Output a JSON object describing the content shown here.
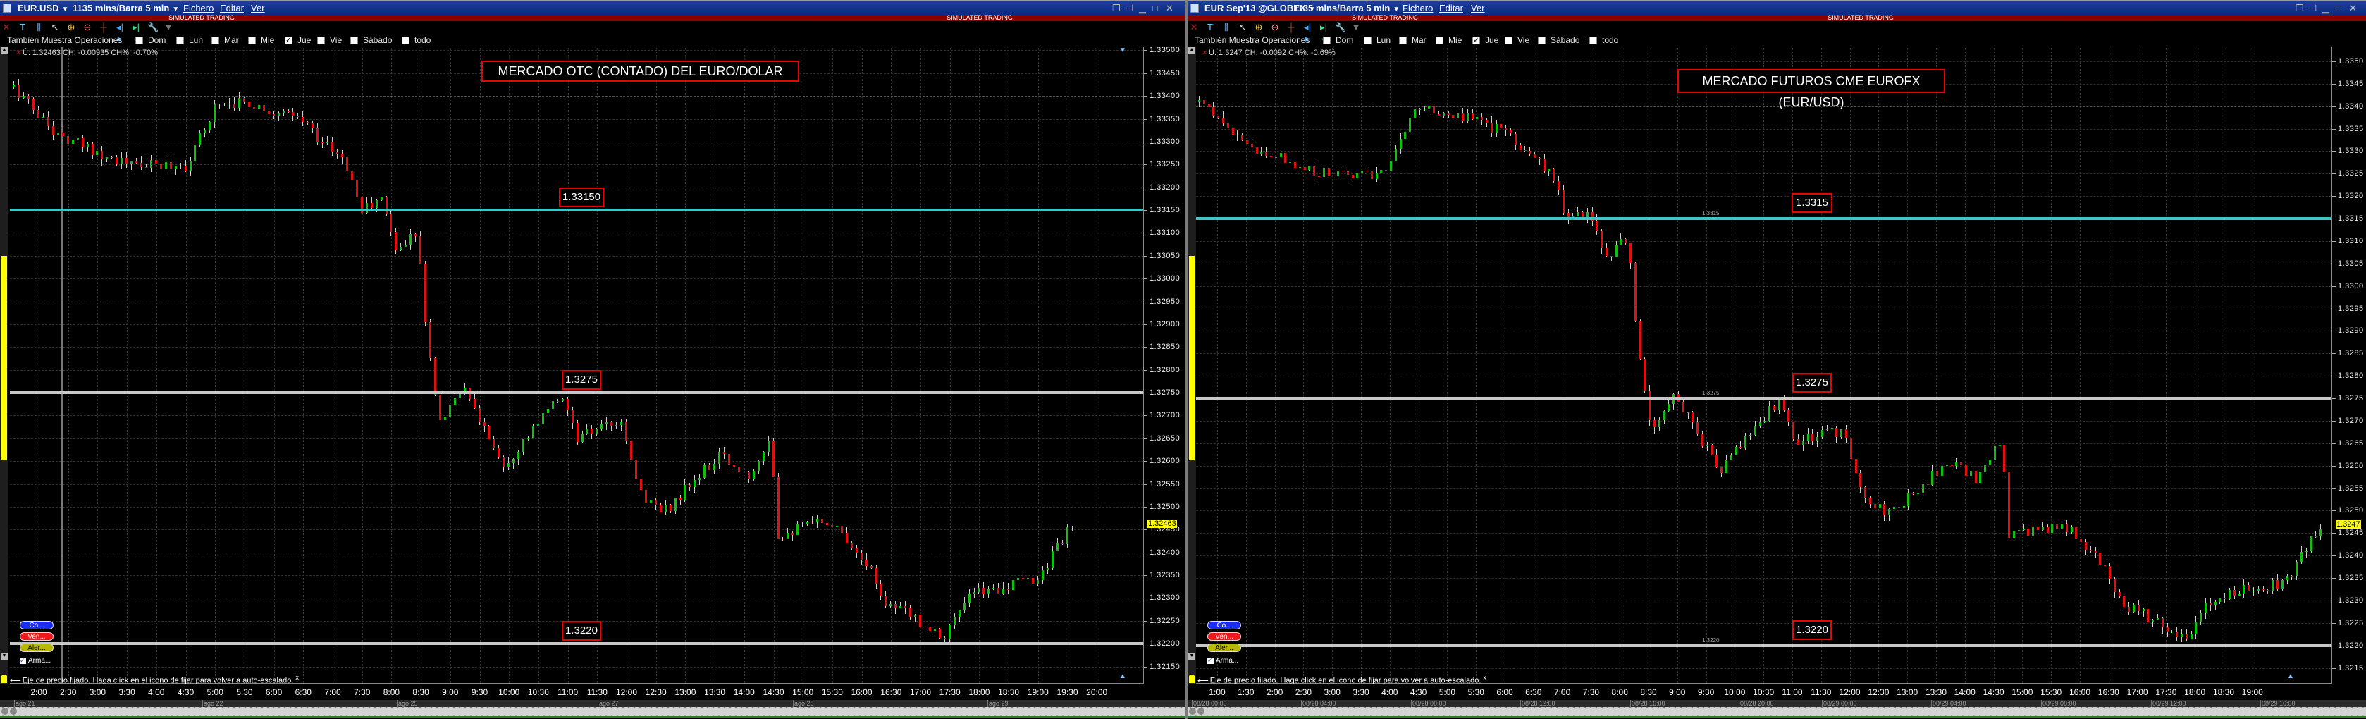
{
  "panels": [
    {
      "symbol": "EUR.USD",
      "period": "1135 mins/Barra 5 min",
      "menus": [
        "Fichero",
        "Editar",
        "Ver"
      ],
      "banner": "SIMULATED TRADING",
      "toolbar_icons": [
        "remove-icon",
        "text-tool-icon",
        "bar-chart-icon",
        "draw-line-icon",
        "zoom-in-icon",
        "zoom-out-icon",
        "crosshair-icon",
        "expand-icon",
        "compress-icon",
        "wrench-icon",
        "dropdown-icon"
      ],
      "window_controls": [
        "restore-windows-icon",
        "pin-icon",
        "minimize-icon",
        "maximize-icon",
        "close-icon"
      ],
      "trades_label": "También Muestra Operaciones",
      "days": [
        {
          "label": "Dom",
          "checked": false
        },
        {
          "label": "Lun",
          "checked": false
        },
        {
          "label": "Mar",
          "checked": false
        },
        {
          "label": "Mie",
          "checked": false
        },
        {
          "label": "Jue",
          "checked": true
        },
        {
          "label": "Vie",
          "checked": false
        },
        {
          "label": "Sábado",
          "checked": false
        },
        {
          "label": "todo",
          "checked": false
        }
      ],
      "info": "Ú: 1.32463 CH: -0.00935 CH%: -0.70%",
      "title_annotation": "MERCADO OTC (CONTADO) DEL EURO/DOLAR",
      "levels": [
        {
          "price": 1.3315,
          "label": "1.33150",
          "color": "#3cc6c6"
        },
        {
          "price": 1.3275,
          "label": "1.3275",
          "color": "#c8c8c8"
        },
        {
          "price": 1.322,
          "label": "1.3220",
          "color": "#c8c8c8"
        }
      ],
      "price_ticks": [
        "1.33500",
        "1.33450",
        "1.33400",
        "1.33350",
        "1.33300",
        "1.33250",
        "1.33200",
        "1.33150",
        "1.33100",
        "1.33050",
        "1.33000",
        "1.32950",
        "1.32900",
        "1.32850",
        "1.32800",
        "1.32750",
        "1.32700",
        "1.32650",
        "1.32600",
        "1.32550",
        "1.32500",
        "1.32450",
        "1.32400",
        "1.32350",
        "1.32300",
        "1.32250",
        "1.32200",
        "1.32150"
      ],
      "last_price": "1.32463",
      "time_ticks": [
        "2:00",
        "2:30",
        "3:00",
        "3:30",
        "4:00",
        "4:30",
        "5:00",
        "5:30",
        "6:00",
        "6:30",
        "7:00",
        "7:30",
        "8:00",
        "8:30",
        "9:00",
        "9:30",
        "10:00",
        "10:30",
        "11:00",
        "11:30",
        "12:00",
        "12:30",
        "13:00",
        "13:30",
        "14:00",
        "14:30",
        "15:00",
        "15:30",
        "16:00",
        "16:30",
        "17:00",
        "17:30",
        "18:00",
        "18:30",
        "19:00",
        "19:30",
        "20:00"
      ],
      "date_marks": [
        "ago 21",
        "ago 22",
        "ago 25",
        "ago 27",
        "ago 28",
        "ago 29"
      ],
      "order_buttons": [
        {
          "label": "Co...",
          "color": "#1a2cf0"
        },
        {
          "label": "Ven...",
          "color": "#f01818"
        },
        {
          "label": "Aler...",
          "color": "#b8b800"
        }
      ],
      "arma_label": "Arma...",
      "fixed_axis_msg": "Eje de precio fijado. Haga click en el icono de fijar para volver a auto-escalado.",
      "dismiss_label": "x"
    },
    {
      "symbol": "EUR Sep'13 @GLOBEX",
      "period": "1135 mins/Barra 5 min",
      "menus": [
        "Fichero",
        "Editar",
        "Ver"
      ],
      "banner": "SIMULATED TRADING",
      "toolbar_icons": [
        "remove-icon",
        "text-tool-icon",
        "bar-chart-icon",
        "draw-line-icon",
        "zoom-in-icon",
        "zoom-out-icon",
        "crosshair-icon",
        "expand-icon",
        "compress-icon",
        "wrench-icon",
        "dropdown-icon"
      ],
      "window_controls": [
        "restore-windows-icon",
        "pin-icon",
        "minimize-icon",
        "maximize-icon",
        "close-icon"
      ],
      "trades_label": "También Muestra Operaciones",
      "days": [
        {
          "label": "Dom",
          "checked": false
        },
        {
          "label": "Lun",
          "checked": false
        },
        {
          "label": "Mar",
          "checked": false
        },
        {
          "label": "Mie",
          "checked": false
        },
        {
          "label": "Jue",
          "checked": true
        },
        {
          "label": "Vie",
          "checked": false
        },
        {
          "label": "Sábado",
          "checked": false
        },
        {
          "label": "todo",
          "checked": false
        }
      ],
      "info": "Ú: 1.3247 CH: -0.0092 CH%: -0.69%",
      "title_annotation": "MERCADO FUTUROS CME EUROFX (EUR/USD)",
      "levels": [
        {
          "price": 1.3315,
          "label": "1.3315",
          "color": "#3cc6c6"
        },
        {
          "price": 1.3275,
          "label": "1.3275",
          "color": "#c8c8c8"
        },
        {
          "price": 1.322,
          "label": "1.3220",
          "color": "#c8c8c8"
        }
      ],
      "price_ticks": [
        "1.3350",
        "1.3345",
        "1.3340",
        "1.3335",
        "1.3330",
        "1.3325",
        "1.3320",
        "1.3315",
        "1.3310",
        "1.3305",
        "1.3300",
        "1.3295",
        "1.3290",
        "1.3285",
        "1.3280",
        "1.3275",
        "1.3270",
        "1.3265",
        "1.3260",
        "1.3255",
        "1.3250",
        "1.3245",
        "1.3240",
        "1.3235",
        "1.3230",
        "1.3225",
        "1.3220",
        "1.3215"
      ],
      "last_price": "1.3247",
      "time_ticks": [
        "1:00",
        "1:30",
        "2:00",
        "2:30",
        "3:00",
        "3:30",
        "4:00",
        "4:30",
        "5:00",
        "5:30",
        "6:00",
        "6:30",
        "7:00",
        "7:30",
        "8:00",
        "8:30",
        "9:00",
        "9:30",
        "10:00",
        "10:30",
        "11:00",
        "11:30",
        "12:00",
        "12:30",
        "13:00",
        "13:30",
        "14:00",
        "14:30",
        "15:00",
        "15:30",
        "16:00",
        "16:30",
        "17:00",
        "17:30",
        "18:00",
        "18:30",
        "19:00"
      ],
      "date_marks": [
        "08/28 00:00",
        "08/28 04:00",
        "08/28 08:00",
        "08/28 12:00",
        "08/28 16:00",
        "08/28 20:00",
        "08/29 00:00",
        "08/29 04:00",
        "08/29 08:00",
        "08/29 12:00",
        "08/29 16:00"
      ],
      "order_buttons": [
        {
          "label": "Co...",
          "color": "#1a2cf0"
        },
        {
          "label": "Ven...",
          "color": "#f01818"
        },
        {
          "label": "Aler...",
          "color": "#b8b800"
        }
      ],
      "arma_label": "Arma...",
      "fixed_axis_msg": "Eje de precio fijado. Haga click en el icono de fijar para volver a auto-escalado.",
      "dismiss_label": "x"
    }
  ],
  "chart_data": [
    {
      "type": "candlestick",
      "title": "MERCADO OTC (CONTADO) DEL EURO/DOLAR",
      "bar_minutes": 5,
      "ylim": [
        1.32125,
        1.3352
      ],
      "path_hour_price": [
        [
          1.56,
          1.33419
        ],
        [
          2.32,
          1.33312
        ],
        [
          3.55,
          1.33248
        ],
        [
          4.52,
          1.33248
        ],
        [
          5.01,
          1.33387
        ],
        [
          5.5,
          1.33387
        ],
        [
          6.48,
          1.33345
        ],
        [
          7.22,
          1.33248
        ],
        [
          7.46,
          1.3315
        ],
        [
          7.83,
          1.33173
        ],
        [
          8.07,
          1.3306
        ],
        [
          8.44,
          1.3311
        ],
        [
          8.56,
          1.32897
        ],
        [
          8.8,
          1.32684
        ],
        [
          9.17,
          1.32765
        ],
        [
          9.9,
          1.32594
        ],
        [
          10.39,
          1.32668
        ],
        [
          10.88,
          1.32748
        ],
        [
          11.12,
          1.32651
        ],
        [
          11.87,
          1.32684
        ],
        [
          12.23,
          1.32529
        ],
        [
          12.6,
          1.32487
        ],
        [
          13.57,
          1.32611
        ],
        [
          14.06,
          1.3257
        ],
        [
          14.43,
          1.3266
        ],
        [
          14.55,
          1.32439
        ],
        [
          15.41,
          1.32472
        ],
        [
          16.02,
          1.3239
        ],
        [
          16.39,
          1.32292
        ],
        [
          17.37,
          1.32219
        ],
        [
          17.86,
          1.32309
        ],
        [
          18.96,
          1.32341
        ],
        [
          19.57,
          1.32463
        ]
      ]
    },
    {
      "type": "candlestick",
      "title": "MERCADO FUTUROS CME EUROFX (EUR/USD)",
      "bar_minutes": 5,
      "ylim": [
        1.3213,
        1.3352
      ],
      "path_hour_price": [
        [
          0.67,
          1.3341
        ],
        [
          1.49,
          1.3331
        ],
        [
          2.83,
          1.3325
        ],
        [
          3.88,
          1.3325
        ],
        [
          4.41,
          1.3339
        ],
        [
          4.94,
          1.3339
        ],
        [
          6.0,
          1.3334
        ],
        [
          6.81,
          1.3325
        ],
        [
          7.07,
          1.3315
        ],
        [
          7.47,
          1.3317
        ],
        [
          7.73,
          1.3306
        ],
        [
          8.13,
          1.3311
        ],
        [
          8.26,
          1.329
        ],
        [
          8.52,
          1.3268
        ],
        [
          8.92,
          1.3276
        ],
        [
          9.71,
          1.3259
        ],
        [
          10.24,
          1.3267
        ],
        [
          10.77,
          1.3275
        ],
        [
          11.03,
          1.3265
        ],
        [
          11.85,
          1.3268
        ],
        [
          12.24,
          1.3253
        ],
        [
          12.64,
          1.3249
        ],
        [
          13.69,
          1.3261
        ],
        [
          14.22,
          1.3257
        ],
        [
          14.62,
          1.3266
        ],
        [
          14.75,
          1.3244
        ],
        [
          15.68,
          1.3247
        ],
        [
          16.35,
          1.3239
        ],
        [
          16.75,
          1.3229
        ],
        [
          17.81,
          1.3222
        ],
        [
          18.34,
          1.3231
        ],
        [
          19.53,
          1.3234
        ],
        [
          20.19,
          1.3247
        ]
      ]
    }
  ]
}
